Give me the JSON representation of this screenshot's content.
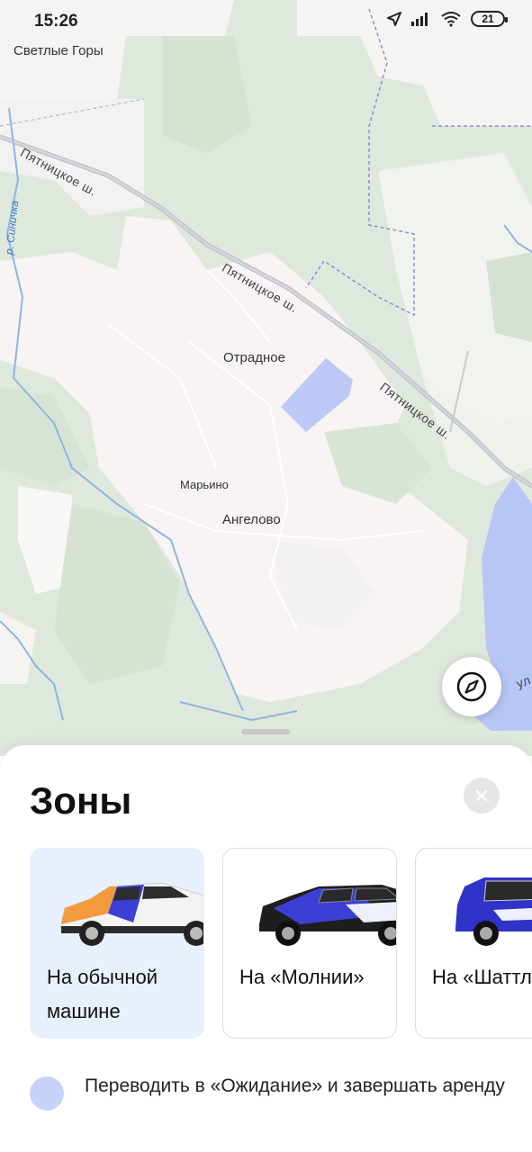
{
  "status_bar": {
    "time": "15:26",
    "battery": "21"
  },
  "map": {
    "places": {
      "svetlye_gory": "Светлые Горы",
      "otradnoe": "Отрадное",
      "marino": "Марьино",
      "angelovo": "Ангелово"
    },
    "roads": {
      "road_1": "Пятницкое ш.",
      "road_2": "Пятницкое ш.",
      "road_3": "Пятницкое ш.",
      "street_partial": "ул."
    },
    "rivers": {
      "sinichka": "р. Синичка"
    },
    "zone_color": "#b8c6f6"
  },
  "sheet": {
    "title": "Зоны",
    "cards": [
      {
        "label": "На обычной\nмашине",
        "selected": true
      },
      {
        "label": "На «Молнии»",
        "selected": false
      },
      {
        "label": "На «Шаттл",
        "selected": false
      }
    ],
    "legend": {
      "color": "#c8d3fa",
      "text": "Переводить в «Ожидание» и завершать аренду"
    }
  }
}
